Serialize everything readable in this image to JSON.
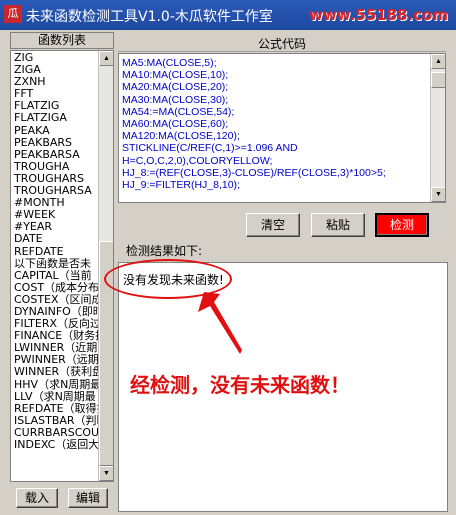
{
  "window": {
    "title": "未来函数检测工具V1.0-木瓜软件工作室",
    "watermark": "www.55188.com",
    "icon_glyph": "瓜"
  },
  "function_list": {
    "header": "函数列表",
    "items": [
      "ZIG",
      "ZIGA",
      "ZXNH",
      "FFT",
      "FLATZIG",
      "FLATZIGA",
      "PEAKA",
      "PEAKBARS",
      "PEAKBARSA",
      "TROUGHA",
      "TROUGHARS",
      "TROUGHARSA",
      "#MONTH",
      "#WEEK",
      "#YEAR",
      "DATE",
      "REFDATE",
      "以下函数是否未",
      "CAPITAL（当前",
      "COST（成本分布",
      "COSTEX（区间成",
      "DYNAINFO（即时",
      "FILTERX（反向过",
      "FINANCE（财务指",
      "LWINNER（近期获",
      "PWINNER（远期获",
      "WINNER（获利盘",
      "HHV（求N周期最",
      "LLV（求N周期最",
      "REFDATE（取得指",
      "ISLASTBAR（判断",
      "CURRBARSCOUNT",
      "INDEXC（返回大"
    ],
    "load_button": "载入",
    "edit_button": "编辑"
  },
  "code_panel": {
    "header": "公式代码",
    "lines": [
      "MA5:MA(CLOSE,5);",
      "MA10:MA(CLOSE,10);",
      "MA20:MA(CLOSE,20);",
      "MA30:MA(CLOSE,30);",
      "MA54:=MA(CLOSE,54);",
      "MA60:MA(CLOSE,60);",
      "MA120:MA(CLOSE,120);",
      "STICKLINE(C/REF(C,1)>=1.096 AND",
      "H=C,O,C,2,0),COLORYELLOW;",
      "HJ_8:=(REF(CLOSE,3)-CLOSE)/REF(CLOSE,3)*100>5;",
      "HJ_9:=FILTER(HJ_8,10);"
    ],
    "clear_button": "清空",
    "paste_button": "粘贴",
    "check_button": "检测"
  },
  "result_panel": {
    "label": "检测结果如下:",
    "text": "没有发现未来函数!"
  },
  "annotation": {
    "text": "经检测，没有未来函数！",
    "color": "#e01010"
  },
  "colors": {
    "titlebar": "#1f49a0",
    "code_text": "#0000cc",
    "check_button_bg": "#ff0000"
  }
}
